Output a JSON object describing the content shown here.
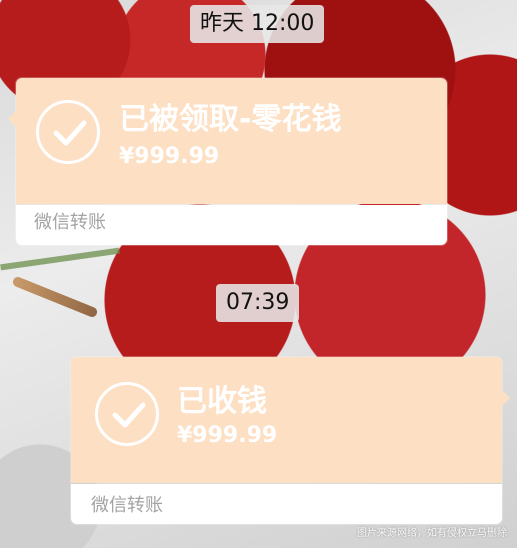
{
  "timestamps": {
    "first": "昨天 12:00",
    "second": "07:39"
  },
  "messages": [
    {
      "title": "已被领取-零花钱",
      "amount": "¥999.99",
      "label": "微信转账"
    },
    {
      "title": "已收钱",
      "amount": "¥999.99",
      "label": "微信转账"
    }
  ],
  "watermark": "图片来源网络，如有侵权立马删除",
  "icons": {
    "received": "checkmark-icon"
  },
  "colors": {
    "card_top": "#fddfc3",
    "card_bottom": "#ffffff",
    "text_white": "#ffffff",
    "label_gray": "#a3a3a3"
  }
}
